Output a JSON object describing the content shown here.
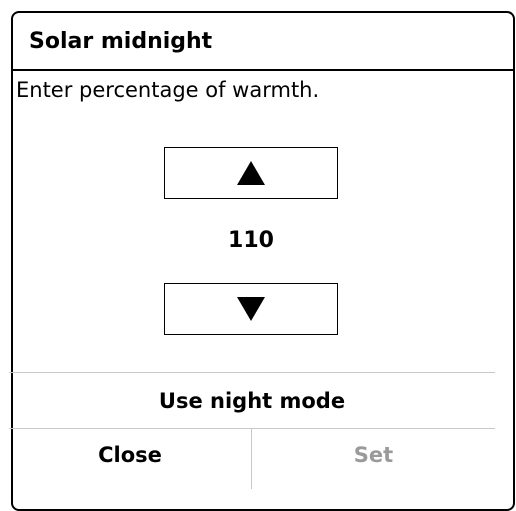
{
  "dialog": {
    "title": "Solar midnight",
    "prompt": "Enter percentage of warmth.",
    "value": "110",
    "increase_icon": "up-triangle-icon",
    "decrease_icon": "down-triangle-icon",
    "night_mode_label": "Use night mode",
    "close_label": "Close",
    "set_label": "Set"
  },
  "colors": {
    "text": "#000000",
    "disabled_text": "#9a9a9a",
    "divider": "#c8c8c8",
    "background": "#ffffff"
  }
}
